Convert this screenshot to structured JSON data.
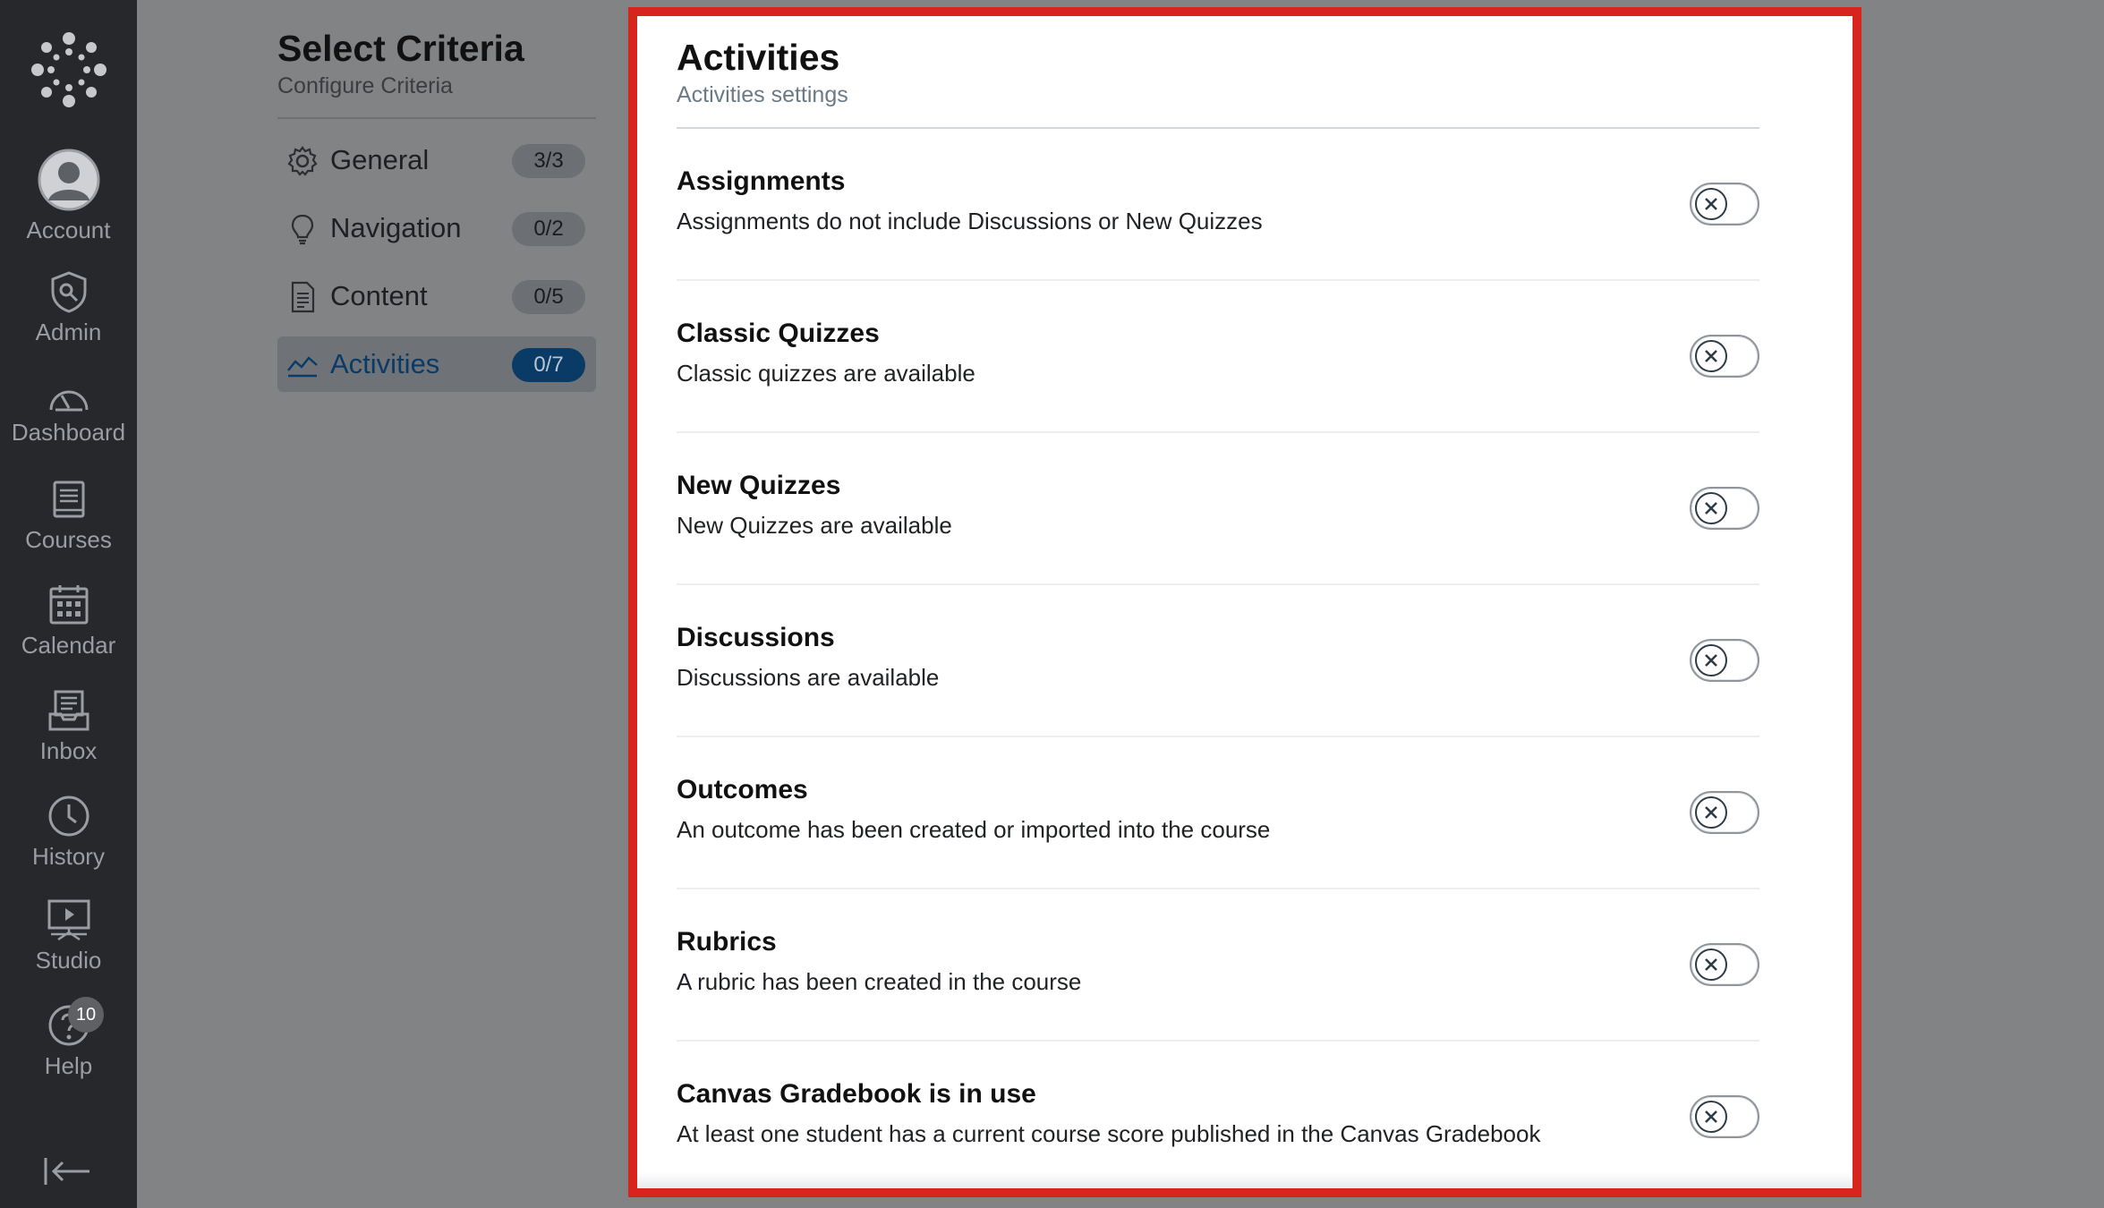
{
  "nav": {
    "items": [
      {
        "id": "account",
        "label": "Account",
        "icon": "account-icon"
      },
      {
        "id": "admin",
        "label": "Admin",
        "icon": "admin-icon"
      },
      {
        "id": "dashboard",
        "label": "Dashboard",
        "icon": "dashboard-icon"
      },
      {
        "id": "courses",
        "label": "Courses",
        "icon": "courses-icon"
      },
      {
        "id": "calendar",
        "label": "Calendar",
        "icon": "calendar-icon"
      },
      {
        "id": "inbox",
        "label": "Inbox",
        "icon": "inbox-icon"
      },
      {
        "id": "history",
        "label": "History",
        "icon": "history-icon"
      },
      {
        "id": "studio",
        "label": "Studio",
        "icon": "studio-icon"
      },
      {
        "id": "help",
        "label": "Help",
        "icon": "help-icon",
        "badge": "10"
      }
    ]
  },
  "criteria": {
    "title": "Select Criteria",
    "subtitle": "Configure Criteria",
    "items": [
      {
        "label": "General",
        "count": "3/3",
        "icon": "gear-icon",
        "active": false
      },
      {
        "label": "Navigation",
        "count": "0/2",
        "icon": "lightbulb-icon",
        "active": false
      },
      {
        "label": "Content",
        "count": "0/5",
        "icon": "document-icon",
        "active": false
      },
      {
        "label": "Activities",
        "count": "0/7",
        "icon": "line-chart-icon",
        "active": true
      }
    ]
  },
  "activities": {
    "title": "Activities",
    "subtitle": "Activities settings",
    "rows": [
      {
        "title": "Assignments",
        "description": "Assignments do not include Discussions or New Quizzes",
        "enabled": false
      },
      {
        "title": "Classic Quizzes",
        "description": "Classic quizzes are available",
        "enabled": false
      },
      {
        "title": "New Quizzes",
        "description": "New Quizzes are available",
        "enabled": false
      },
      {
        "title": "Discussions",
        "description": "Discussions are available",
        "enabled": false
      },
      {
        "title": "Outcomes",
        "description": "An outcome has been created or imported into the course",
        "enabled": false
      },
      {
        "title": "Rubrics",
        "description": "A rubric has been created in the course",
        "enabled": false
      },
      {
        "title": "Canvas Gradebook is in use",
        "description": "At least one student has a current course score published in the Canvas Gradebook",
        "enabled": false
      }
    ]
  },
  "colors": {
    "nav_bg": "#26282b",
    "overlay_bg": "#828385",
    "accent_blue": "#0a3a66",
    "highlight_border": "#d7251d"
  }
}
